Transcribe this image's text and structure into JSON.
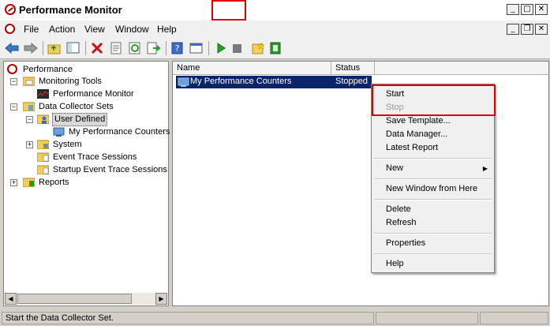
{
  "window": {
    "title": "Performance Monitor"
  },
  "menu": {
    "items": [
      "File",
      "Action",
      "View",
      "Window",
      "Help"
    ]
  },
  "toolbar": {
    "buttons": [
      "back-icon",
      "forward-icon",
      "up-folder-icon",
      "show-hide-tree-icon",
      "delete-icon",
      "properties-icon",
      "refresh-icon",
      "export-icon",
      "help-icon",
      "show-pane-icon",
      "start-icon",
      "stop-icon",
      "new-icon",
      "report-icon"
    ],
    "highlighted": [
      "start-icon",
      "stop-icon"
    ]
  },
  "tree": {
    "items": [
      {
        "label": "Performance"
      },
      {
        "label": "Monitoring Tools"
      },
      {
        "label": "Performance Monitor"
      },
      {
        "label": "Data Collector Sets"
      },
      {
        "label": "User Defined"
      },
      {
        "label": "My Performance Counters"
      },
      {
        "label": "System"
      },
      {
        "label": "Event Trace Sessions"
      },
      {
        "label": "Startup Event Trace Sessions"
      },
      {
        "label": "Reports"
      }
    ]
  },
  "list": {
    "columns": [
      "Name",
      "Status"
    ],
    "rows": [
      {
        "name": "My Performance Counters",
        "status": "Stopped"
      }
    ]
  },
  "context_menu": {
    "items": [
      "Start",
      "Stop",
      "Save Template...",
      "Data Manager...",
      "Latest Report",
      "New",
      "New Window from Here",
      "Delete",
      "Refresh",
      "Properties",
      "Help"
    ],
    "disabled": [
      "Stop"
    ],
    "highlighted": [
      "Start",
      "Stop"
    ]
  },
  "status": {
    "text": "Start the Data Collector Set."
  },
  "colors": {
    "selection": "#0a246a",
    "highlight_box": "#e00000",
    "play_green": "#1fa81f"
  }
}
